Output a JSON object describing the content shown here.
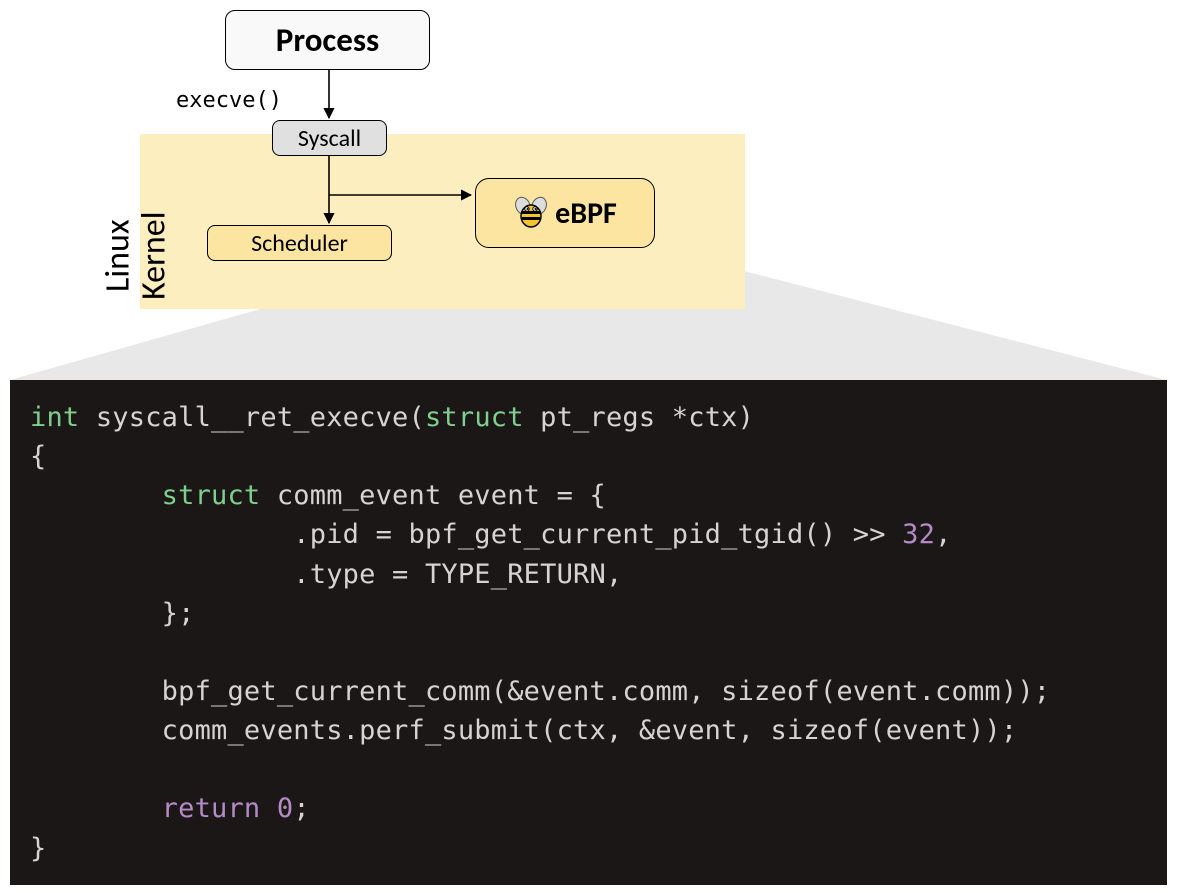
{
  "diagram": {
    "process_label": "Process",
    "execve_label": "execve()",
    "syscall_label": "Syscall",
    "scheduler_label": "Scheduler",
    "ebpf_label": "eBPF",
    "kernel_label_line1": "Linux",
    "kernel_label_line2": "Kernel"
  },
  "code": {
    "tok_int": "int",
    "fn_name": " syscall__ret_execve(",
    "tok_struct1": "struct",
    "sig_rest": " pt_regs *ctx)",
    "brace_open": "{",
    "tok_struct2": "struct",
    "decl_rest": " comm_event event = {",
    "pid_pre": ".pid = bpf_get_current_pid_tgid() >> ",
    "pid_num": "32",
    "pid_post": ",",
    "type_line": ".type = TYPE_RETURN,",
    "struct_close": "};",
    "call1": "bpf_get_current_comm(&event.comm, sizeof(event.comm));",
    "call2": "comm_events.perf_submit(ctx, &event, sizeof(event));",
    "tok_return": "return",
    "ret_sp": " ",
    "ret_num": "0",
    "ret_semi": ";",
    "brace_close": "}"
  }
}
